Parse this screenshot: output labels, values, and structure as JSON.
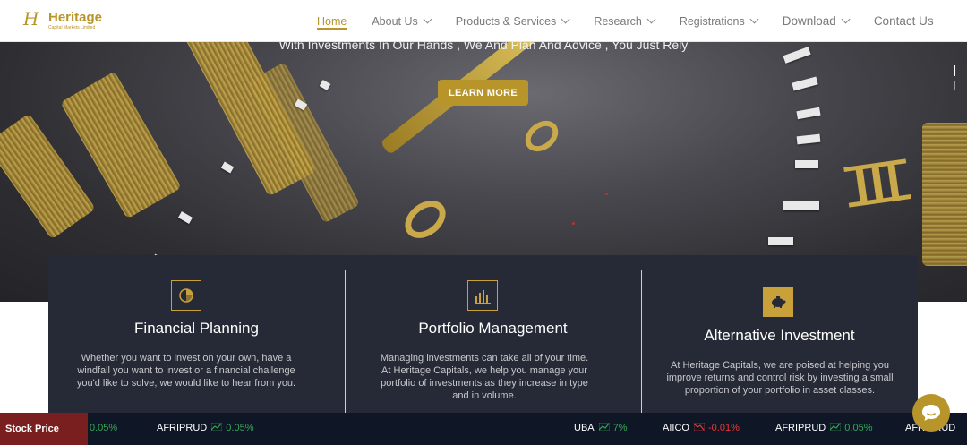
{
  "header": {
    "logo_letter": "H",
    "logo_word": "Heritage",
    "logo_sub": "Capital Markets Limited",
    "nav": [
      {
        "label": "Home",
        "active": true,
        "dropdown": false
      },
      {
        "label": "About Us",
        "active": false,
        "dropdown": true
      },
      {
        "label": "Products & Services",
        "active": false,
        "dropdown": true
      },
      {
        "label": "Research",
        "active": false,
        "dropdown": true
      },
      {
        "label": "Registrations",
        "active": false,
        "dropdown": true
      },
      {
        "label": "Download",
        "active": false,
        "dropdown": true
      },
      {
        "label": "Contact Us",
        "active": false,
        "dropdown": false
      }
    ]
  },
  "hero": {
    "tagline": "With Investments In Our Hands , We And Plan And Advice , You Just Rely",
    "cta_label": "LEARN MORE"
  },
  "services": [
    {
      "title": "Financial Planning",
      "icon": "pie-chart-icon",
      "text": "Whether you want to invest on your own, have a windfall you want to invest or a financial challenge you'd like to solve, we would like to hear from you."
    },
    {
      "title": "Portfolio Management",
      "icon": "bar-chart-icon",
      "text": "Managing investments can take all of your time. At Heritage Capitals, we help you manage your portfolio of investments as they increase in type and in volume."
    },
    {
      "title": "Alternative Investment",
      "icon": "piggy-bank-icon",
      "text": "At Heritage Capitals, we are poised at helping you improve returns and control risk by investing a small proportion of your portfolio in asset classes."
    }
  ],
  "ticker": {
    "label": "Stock Price",
    "items": [
      {
        "symbol": "",
        "change": "0.05%",
        "direction": "up"
      },
      {
        "symbol": "AFRIPRUD",
        "change": "0.05%",
        "direction": "up"
      },
      {
        "symbol": "UBA",
        "change": "7%",
        "direction": "up"
      },
      {
        "symbol": "AIICO",
        "change": "-0.01%",
        "direction": "down"
      },
      {
        "symbol": "AFRIPRUD",
        "change": "0.05%",
        "direction": "up"
      },
      {
        "symbol": "AFRIPRUD",
        "change": "",
        "direction": "up"
      }
    ]
  },
  "colors": {
    "brand_gold": "#b8952b",
    "panel_bg": "#262a36",
    "ticker_bg": "#0f1726",
    "ticker_label_bg": "#7a1f1f",
    "up": "#34a853",
    "down": "#e53935"
  }
}
